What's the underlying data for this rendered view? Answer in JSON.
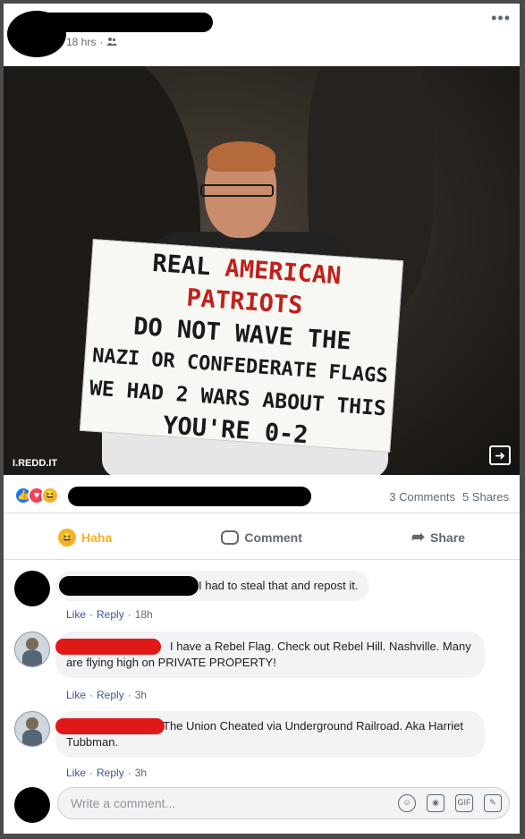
{
  "post": {
    "timestamp": "18 hrs",
    "audience_icon": "friends-icon",
    "more_label": "•••"
  },
  "photo": {
    "sign_lines": [
      "AMERICAN PATRIOTS",
      "DO NOT WAVE THE",
      "NAZI OR CONFEDERATE FLAGS",
      "WE HAD 2 WARS ABOUT THIS",
      "YOU'RE 0-2"
    ],
    "sign_first_word": "REAL",
    "watermark": "I.REDD.IT"
  },
  "stats": {
    "comments": "3 Comments",
    "shares": "5 Shares"
  },
  "actions": {
    "haha": "Haha",
    "comment": "Comment",
    "share": "Share"
  },
  "comments": [
    {
      "text": "I had to steal that and repost it.",
      "like": "Like",
      "reply": "Reply",
      "time": "18h"
    },
    {
      "text": "I have a Rebel Flag. Check out Rebel Hill. Nashville. Many are flying high on PRIVATE PROPERTY!",
      "like": "Like",
      "reply": "Reply",
      "time": "3h"
    },
    {
      "text": "The Union Cheated via Underground Railroad. Aka Harriet Tubbman.",
      "like": "Like",
      "reply": "Reply",
      "time": "3h"
    }
  ],
  "composer": {
    "placeholder": "Write a comment..."
  },
  "colors": {
    "accent": "#1877f2",
    "haha": "#f7b125",
    "link": "#385898"
  }
}
